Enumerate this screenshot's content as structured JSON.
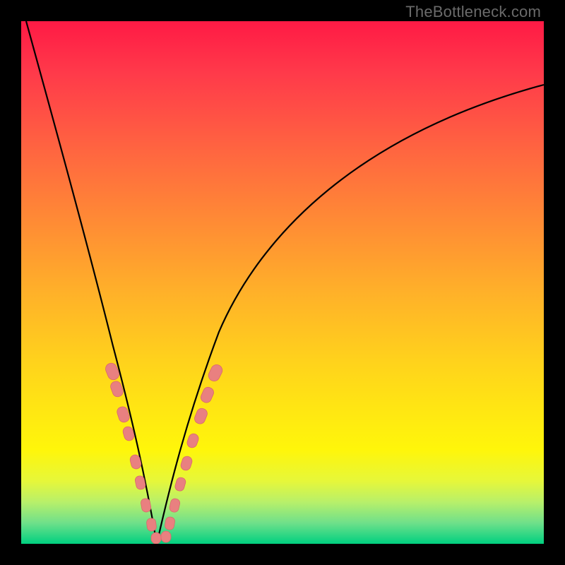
{
  "watermark": "TheBottleneck.com",
  "colors": {
    "frame": "#000000",
    "gradient_stops": [
      "#ff1a45",
      "#ff6640",
      "#ffb129",
      "#ffe812",
      "#6fe08a",
      "#00d080"
    ],
    "curve": "#000000",
    "bead": "#e98080"
  },
  "chart_data": {
    "type": "line",
    "title": "",
    "xlabel": "",
    "ylabel": "",
    "xlim": [
      0,
      100
    ],
    "ylim": [
      0,
      100
    ],
    "notes": "Bottleneck-style V-shaped curves on a red→green vertical gradient. x is a normalized hardware balance axis (0–100); y is an abstract bottleneck severity (0 = none at bottom, 100 = max at top). Minimum of the V lies near x≈26.",
    "series": [
      {
        "name": "left-branch",
        "x": [
          1,
          3,
          6,
          9,
          12,
          15,
          18,
          20,
          22,
          24,
          25,
          26
        ],
        "y": [
          100,
          88,
          74,
          62,
          51,
          41,
          31,
          24,
          17,
          9,
          4,
          0
        ]
      },
      {
        "name": "right-branch",
        "x": [
          26,
          27,
          28,
          30,
          33,
          37,
          42,
          48,
          55,
          63,
          72,
          82,
          92,
          100
        ],
        "y": [
          0,
          3,
          7,
          15,
          25,
          36,
          46,
          55,
          63,
          70,
          76,
          81,
          85,
          88
        ]
      }
    ],
    "beads": {
      "comment": "Pink rounded-rect markers drawn along both branches near the trough.",
      "left_branch_points": [
        [
          17,
          34
        ],
        [
          18,
          30
        ],
        [
          19.5,
          24
        ],
        [
          20.5,
          20
        ],
        [
          22,
          14
        ],
        [
          23,
          10
        ],
        [
          24,
          6
        ],
        [
          25,
          3
        ]
      ],
      "right_branch_points": [
        [
          26,
          1
        ],
        [
          27,
          3
        ],
        [
          28,
          6
        ],
        [
          29,
          10
        ],
        [
          30,
          14
        ],
        [
          31,
          18
        ],
        [
          32.5,
          23
        ],
        [
          33.5,
          27
        ],
        [
          35,
          32
        ]
      ]
    }
  }
}
